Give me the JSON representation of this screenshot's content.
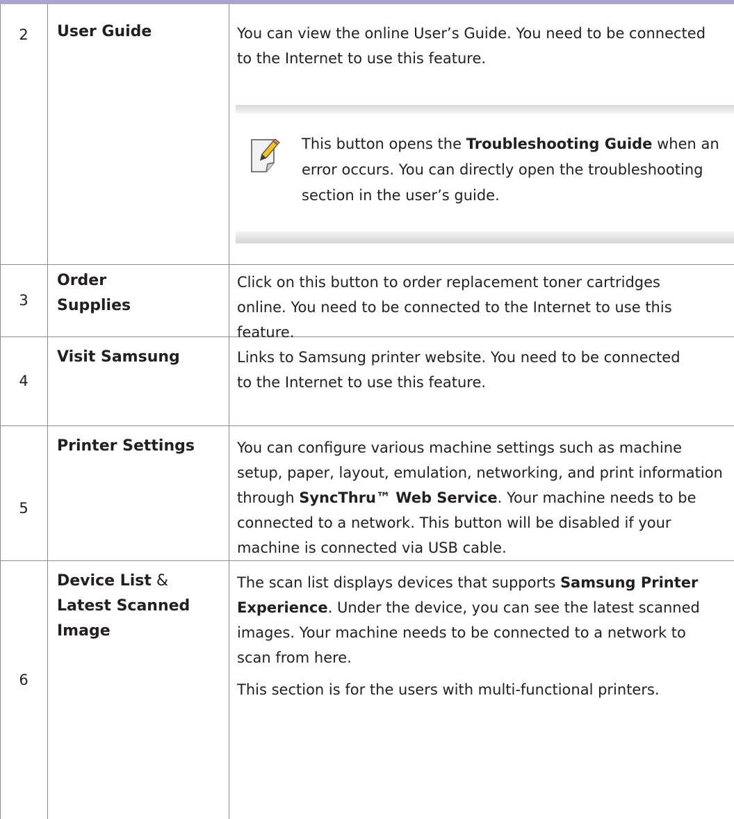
{
  "rows": [
    {
      "number": "2",
      "feature": "User Guide",
      "description": "You can view the online User’s Guide. You need to be connected to the Internet to use this feature.",
      "note": {
        "icon": "note-pencil-icon",
        "text_before": "This button opens the ",
        "bold": "Troubleshooting Guide",
        "text_after": " when an error occurs. You can directly open the troubleshooting section in the user’s guide."
      }
    },
    {
      "number": "3",
      "feature": "Order Supplies",
      "description": "Click on this button to order replacement toner cartridges online. You need to be connected to the Internet to use this feature."
    },
    {
      "number": "4",
      "feature": "Visit Samsung",
      "description": "Links to Samsung printer website. You need to be connected to the Internet to use this feature."
    },
    {
      "number": "5",
      "feature": "Printer Settings",
      "description_before": "You can configure various machine settings such as machine setup, paper, layout, emulation, networking, and print information through ",
      "description_bold": "SyncThru™ Web Service",
      "description_after": ". Your machine needs to be connected to a network. This button will be disabled if your machine is connected via USB cable."
    },
    {
      "number": "6",
      "feature_part1": "Device List",
      "feature_amp": " & ",
      "feature_part2": "Latest Scanned Image",
      "description_before": "The scan list displays devices that supports ",
      "description_bold": "Samsung Printer Experience",
      "description_after": ". Under the device, you can see the latest scanned images. Your machine needs to be connected to a network to scan from here.",
      "description_p2": "This section is for the users with multi-functional printers."
    }
  ],
  "colors": {
    "header_bar": "#a9a7d2",
    "rule": "#8c8c8c",
    "note_band": "#d9d9d9",
    "text": "#231f20"
  }
}
